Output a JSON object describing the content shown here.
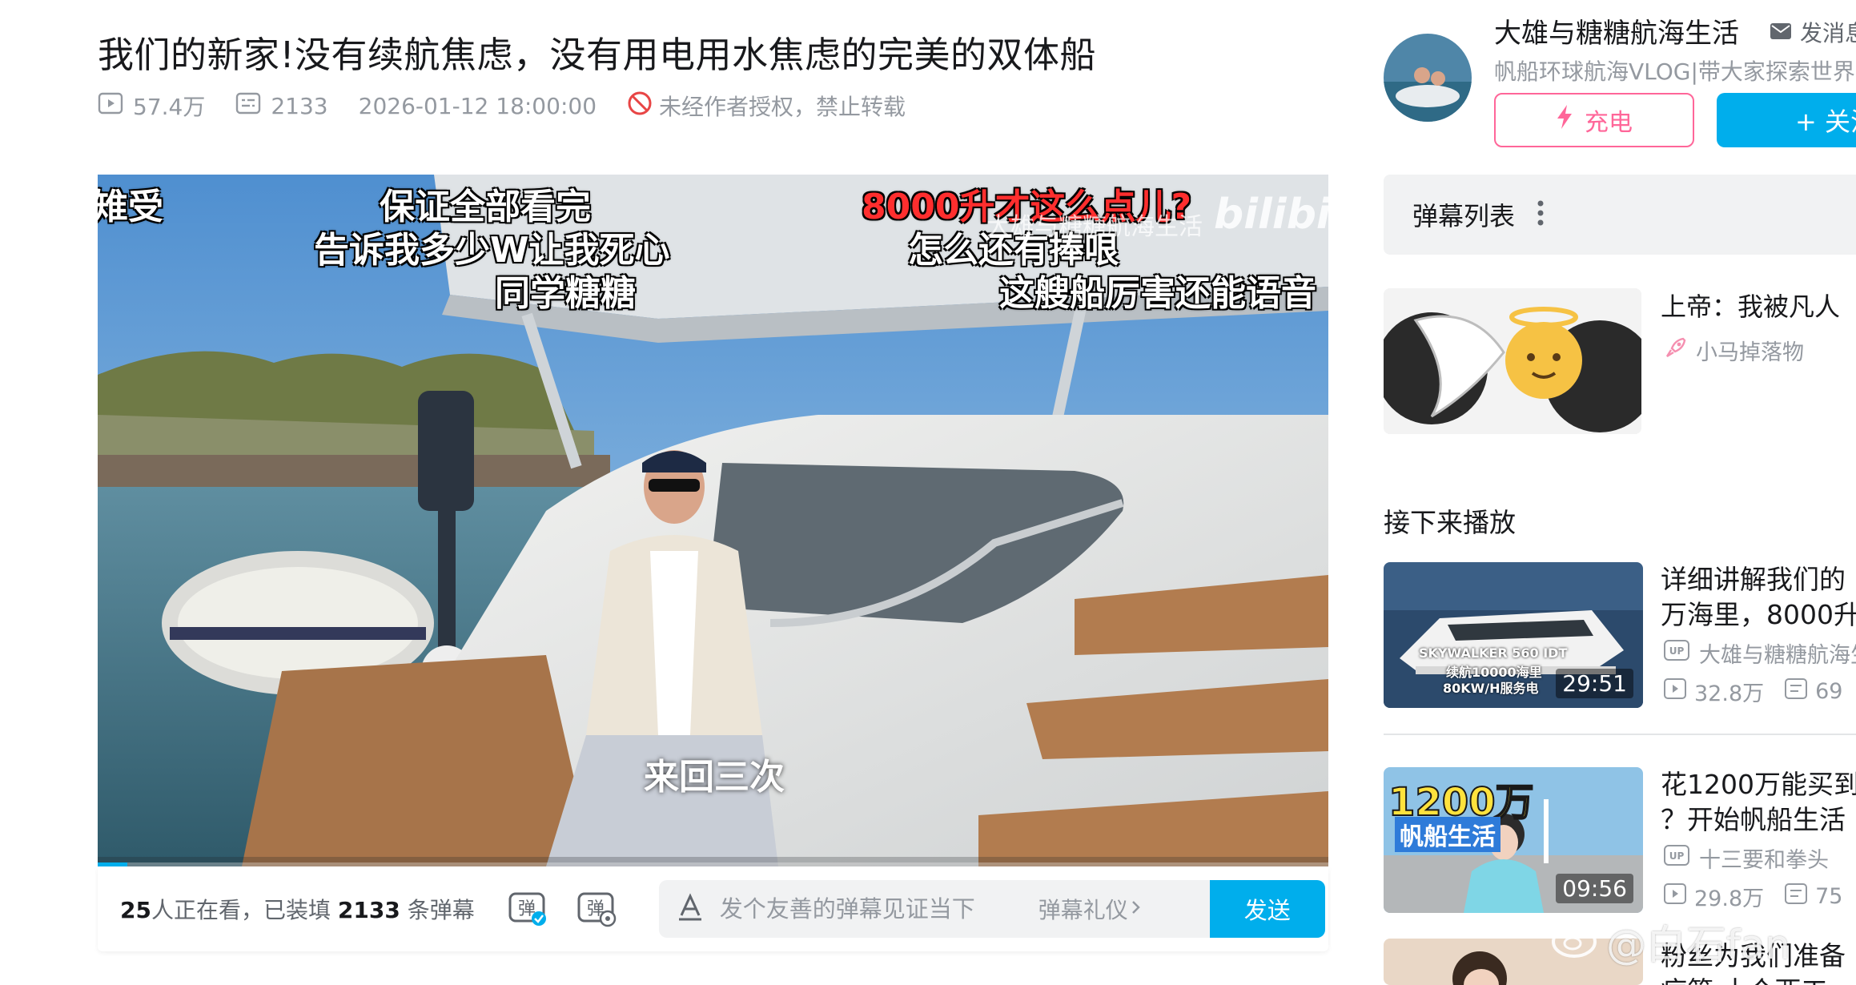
{
  "video": {
    "title": "我们的新家!没有续航焦虑，没有用电用水焦虑的完美的双体船",
    "views": "57.4万",
    "danmaku_count": "2133",
    "publish_time": "2026-01-12 18:00:00",
    "copyright_notice": "未经作者授权，禁止转载",
    "progress": 0.024
  },
  "player": {
    "danmaku": [
      {
        "text": "雉受",
        "color": "#ffffff"
      },
      {
        "text": "保证全部看完",
        "color": "#ffffff"
      },
      {
        "text": "告诉我多少W让我死心",
        "color": "#ffffff"
      },
      {
        "text": "同学糖糖",
        "color": "#ffffff"
      },
      {
        "text": "8000升才这么点儿?",
        "color": "#ff2e2e"
      },
      {
        "text": "怎么还有捧哏",
        "color": "#ffffff"
      },
      {
        "text": "这艘船厉害还能语音",
        "color": "#ffffff"
      }
    ],
    "watermark_text": "大雄与糖糖航海生活",
    "watermark_logo": "bilibili",
    "subtitle": "来回三次"
  },
  "sendbar": {
    "viewers_count": "25",
    "viewers_text": "人正在看，已装填",
    "loaded_count": "2133",
    "loaded_suffix": "条弹幕",
    "input_placeholder": "发个友善的弹幕见证当下",
    "etiquette": "弹幕礼仪",
    "send_label": "发送"
  },
  "uploader": {
    "name": "大雄与糖糖航海生活",
    "message_label": "发消息",
    "description": "帆船环球航海VLOG|带大家探索世界",
    "charge_label": "充电",
    "follow_label": "+ 关注"
  },
  "danmaku_list": {
    "title": "弹幕列表"
  },
  "ad": {
    "title": "上帝：我被凡人",
    "source": "小马掉落物"
  },
  "next_heading": "接下来播放",
  "recommendations": [
    {
      "title_line1": "详细讲解我们的",
      "title_line2": "万海里，8000升",
      "author": "大雄与糖糖航海生活",
      "views": "32.8万",
      "danmaku": "69",
      "duration": "29:51",
      "thumb_text1": "SKYWALKER 560 IDT",
      "thumb_text2": "续航10000海里",
      "thumb_text3": "80KW/H服务电"
    },
    {
      "title_line1": "花1200万能买到",
      "title_line2": "？开始帆船生活",
      "author": "十三要和拳头",
      "views": "29.8万",
      "danmaku": "75",
      "duration": "09:56",
      "thumb_text1": "1200万",
      "thumb_text2": "帆船生活"
    },
    {
      "title_line1": "粉丝为我们准备",
      "title_line2": "痘第 十个西工"
    }
  ],
  "weibo_watermark": "@白石fan",
  "colors": {
    "brand_blue": "#00aeec",
    "charge_pink": "#ff6699",
    "danmaku_red": "#ff2e2e",
    "muted_text": "#9499a0"
  }
}
